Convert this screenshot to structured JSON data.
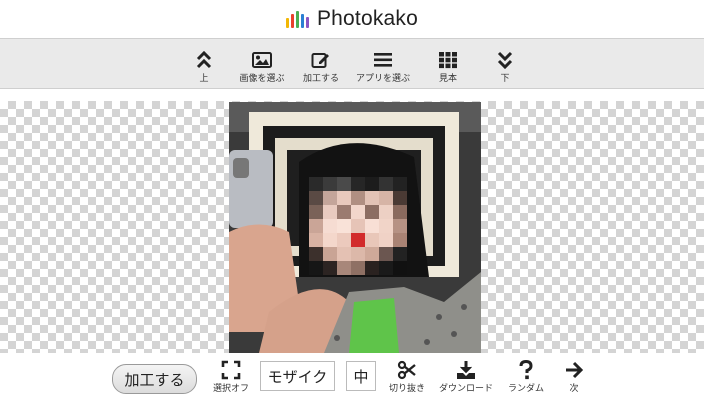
{
  "app": {
    "title": "Photokako",
    "logo_colors": [
      "#f2b705",
      "#e8412c",
      "#4caf50",
      "#2b7fd3",
      "#8a55c4"
    ]
  },
  "toolbar": {
    "items": [
      {
        "label": "上",
        "icon": "double-chevron-up-icon"
      },
      {
        "label": "画像を選ぶ",
        "icon": "image-icon"
      },
      {
        "label": "加工する",
        "icon": "edit-icon"
      },
      {
        "label": "アプリを選ぶ",
        "icon": "list-icon"
      },
      {
        "label": "見本",
        "icon": "grid-icon"
      },
      {
        "label": "下",
        "icon": "double-chevron-down-icon"
      }
    ]
  },
  "bottom": {
    "process_label": "加工する",
    "select_off_label": "選択オフ",
    "effect_value": "モザイク",
    "size_value": "中",
    "crop_label": "切り抜き",
    "download_label": "ダウンロード",
    "random_label": "ランダム",
    "next_label": "次"
  }
}
